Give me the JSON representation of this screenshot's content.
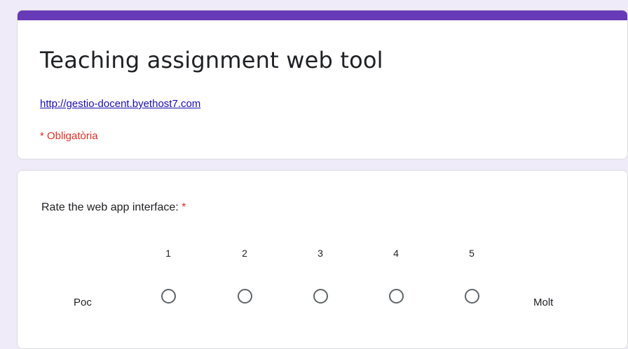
{
  "header": {
    "accent_color": "#673ab7",
    "title": "Teaching assignment web tool",
    "link_text": "http://gestio-docent.byethost7.com",
    "required_note": "* Obligatòria"
  },
  "question": {
    "title": "Rate the web app interface:",
    "required_marker": "*",
    "scale_numbers": [
      "1",
      "2",
      "3",
      "4",
      "5"
    ],
    "low_label": "Poc",
    "high_label": "Molt",
    "selected_value": null
  }
}
